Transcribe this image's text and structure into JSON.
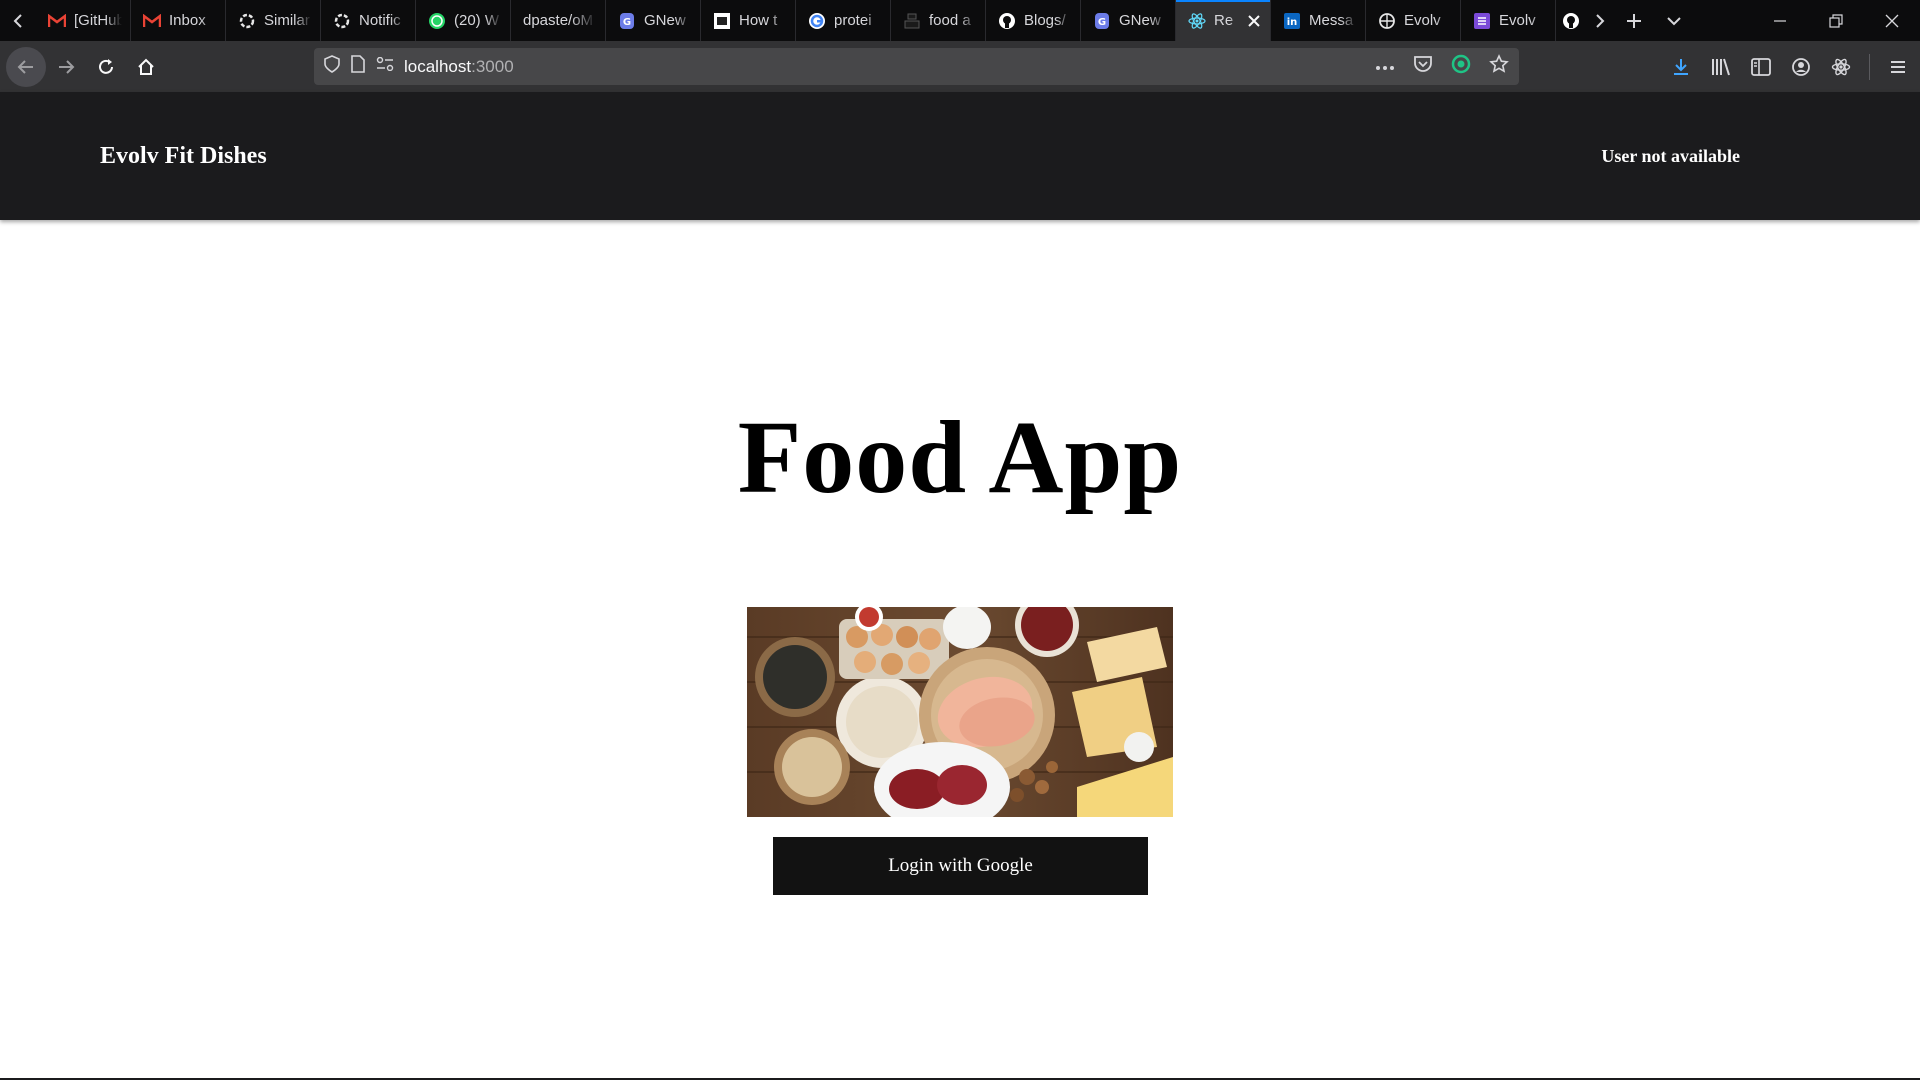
{
  "browser": {
    "tabs": [
      {
        "title": "[GitHub]",
        "icon": "gmail-icon",
        "active": false
      },
      {
        "title": "Inbox",
        "icon": "gmail-icon",
        "active": false
      },
      {
        "title": "Similar",
        "icon": "hashnode-icon",
        "active": false
      },
      {
        "title": "Notific",
        "icon": "hashnode-icon",
        "active": false
      },
      {
        "title": "(20) W",
        "icon": "whatsapp-icon",
        "active": false
      },
      {
        "title": "dpaste/oM",
        "icon": "none",
        "active": false
      },
      {
        "title": "GNew",
        "icon": "gnews-icon",
        "active": false
      },
      {
        "title": "How t",
        "icon": "dg-icon",
        "active": false
      },
      {
        "title": "protei",
        "icon": "google-icon",
        "active": false
      },
      {
        "title": "food a",
        "icon": "unsplash-icon",
        "active": false
      },
      {
        "title": "Blogs/",
        "icon": "github-icon",
        "active": false
      },
      {
        "title": "GNew",
        "icon": "gnews-icon",
        "active": false
      },
      {
        "title": "Re",
        "icon": "react-icon",
        "active": true
      },
      {
        "title": "Messa",
        "icon": "linkedin-icon",
        "active": false
      },
      {
        "title": "Evolv",
        "icon": "globe-icon",
        "active": false
      },
      {
        "title": "Evolv",
        "icon": "list-icon",
        "active": false
      }
    ],
    "url": {
      "host": "localhost",
      "port": ":3000"
    }
  },
  "header": {
    "brand": "Evolv Fit Dishes",
    "user_status": "User not available"
  },
  "main": {
    "title": "Food App",
    "login_label": "Login with Google"
  },
  "colors": {
    "header_bg": "#1b1b1d",
    "button_bg": "#121212",
    "accent": "#0a84ff"
  }
}
